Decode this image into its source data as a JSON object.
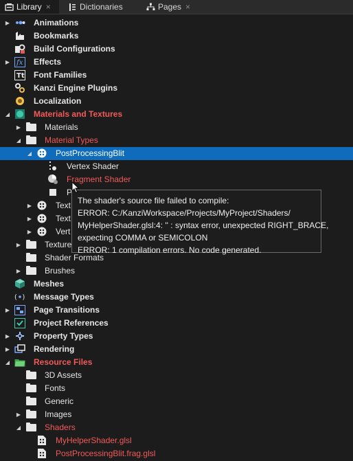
{
  "tabs": [
    {
      "label": "Library",
      "icon": "library-icon",
      "close": "×"
    },
    {
      "label": "Dictionaries",
      "icon": "dictionaries-icon",
      "close": ""
    },
    {
      "label": "Pages",
      "icon": "pages-icon",
      "close": "×"
    }
  ],
  "tree": [
    {
      "label": "Animations",
      "icon": "animations-icon",
      "arrow": "▶"
    },
    {
      "label": "Bookmarks",
      "icon": "bookmarks-icon",
      "arrow": ""
    },
    {
      "label": "Build Configurations",
      "icon": "build-configurations-icon",
      "arrow": ""
    },
    {
      "label": "Effects",
      "icon": "effects-icon",
      "arrow": "▶"
    },
    {
      "label": "Font Families",
      "icon": "font-families-icon",
      "arrow": ""
    },
    {
      "label": "Kanzi Engine Plugins",
      "icon": "plugins-icon",
      "arrow": ""
    },
    {
      "label": "Localization",
      "icon": "localization-icon",
      "arrow": ""
    },
    {
      "label": "Materials and Textures",
      "icon": "materials-textures-icon",
      "arrow": "◢"
    },
    {
      "label": "Materials",
      "icon": "folder-icon",
      "arrow": "▶"
    },
    {
      "label": "Material Types",
      "icon": "folder-icon",
      "arrow": "◢"
    },
    {
      "label": "PostProcessingBlit",
      "icon": "material-type-icon",
      "arrow": "◢"
    },
    {
      "label": "Vertex Shader",
      "icon": "vertex-shader-icon",
      "arrow": ""
    },
    {
      "label": "Fragment Shader",
      "icon": "fragment-shader-icon",
      "arrow": ""
    },
    {
      "label": "P",
      "icon": "property-icon",
      "arrow": ""
    },
    {
      "label": "Text",
      "icon": "material-type-icon",
      "arrow": "▶"
    },
    {
      "label": "Text",
      "icon": "material-type-icon",
      "arrow": "▶"
    },
    {
      "label": "Vert",
      "icon": "material-type-icon",
      "arrow": "▶"
    },
    {
      "label": "Texture",
      "icon": "folder-icon",
      "arrow": "▶"
    },
    {
      "label": "Shader Formats",
      "icon": "folder-icon",
      "arrow": ""
    },
    {
      "label": "Brushes",
      "icon": "folder-icon",
      "arrow": "▶"
    },
    {
      "label": "Meshes",
      "icon": "meshes-icon",
      "arrow": ""
    },
    {
      "label": "Message Types",
      "icon": "message-types-icon",
      "arrow": ""
    },
    {
      "label": "Page Transitions",
      "icon": "page-transitions-icon",
      "arrow": "▶"
    },
    {
      "label": "Project References",
      "icon": "project-references-icon",
      "arrow": ""
    },
    {
      "label": "Property Types",
      "icon": "property-types-icon",
      "arrow": "▶"
    },
    {
      "label": "Rendering",
      "icon": "rendering-icon",
      "arrow": "▶"
    },
    {
      "label": "Resource Files",
      "icon": "resource-files-icon",
      "arrow": "◢"
    },
    {
      "label": "3D Assets",
      "icon": "folder-icon",
      "arrow": ""
    },
    {
      "label": "Fonts",
      "icon": "folder-icon",
      "arrow": ""
    },
    {
      "label": "Generic",
      "icon": "folder-icon",
      "arrow": ""
    },
    {
      "label": "Images",
      "icon": "folder-icon",
      "arrow": "▶"
    },
    {
      "label": "Shaders",
      "icon": "folder-icon",
      "arrow": "◢"
    },
    {
      "label": "MyHelperShader.glsl",
      "icon": "shader-file-icon",
      "arrow": ""
    },
    {
      "label": "PostProcessingBlit.frag.glsl",
      "icon": "shader-file-icon",
      "arrow": ""
    }
  ],
  "tooltip": {
    "lines": [
      "The shader's source file failed to compile:",
      "ERROR: C:/KanziWorkspace/Projects/MyProject/Shaders/",
      "MyHelperShader.glsl:4: '' :  syntax error, unexpected RIGHT_BRACE,",
      "expecting COMMA or SEMICOLON",
      "ERROR: 1 compilation errors.  No code generated."
    ]
  },
  "colors": {
    "background": "#1c1c1c",
    "selection": "#0f6cbd",
    "error_text": "#f25a5a",
    "text": "#e6e6e6"
  }
}
